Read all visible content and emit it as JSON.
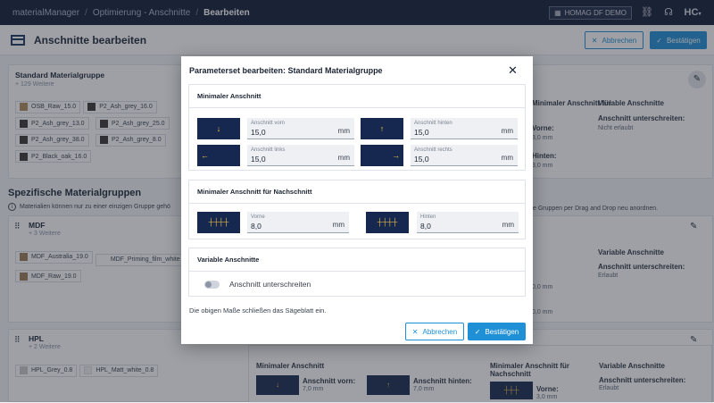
{
  "topbar": {
    "app": "materialManager",
    "crumb1": "Optimierung - Anschnitte",
    "crumb2": "Bearbeiten",
    "demo": "HOMAG DF DEMO",
    "logo": "HC"
  },
  "page": {
    "title": "Anschnitte bearbeiten",
    "cancel": "Abbrechen",
    "confirm": "Bestätigen"
  },
  "bg": {
    "std_title": "Standard Materialgruppe",
    "std_more": "+ 129 Weitere",
    "std_chips": [
      "OSB_Raw_15.0",
      "P2_Ash_grey_16.0",
      "P2_Ash_grey_13.0",
      "P2_Ash_grey_25.0",
      "P2_Ash_grey_38.0",
      "P2_Ash_grey_8.0",
      "P2_Black_oak_16.0"
    ],
    "spec_title": "Spezifische Materialgruppen",
    "info_left": "Materialien können nur zu einer einzigen Gruppe gehö",
    "info_right": "e Gruppen per Drag and Drop neu anordnen.",
    "mdf_title": "MDF",
    "mdf_more": "+ 3 Weitere",
    "mdf_chips": [
      "MDF_Australia_19.0",
      "MDF_Priming_film_white",
      "MDF_Raw_19.0"
    ],
    "hpl_title": "HPL",
    "hpl_more": "+ 2 Weitere",
    "hpl_chips": [
      "HPL_Grey_0.8",
      "HPL_Matt_white_0.8"
    ],
    "col_mn": "Minimaler Anschnitt für",
    "col_var": "Variable Anschnitte",
    "unter": "Anschnitt unterschreiten:",
    "not_allowed": "Nicht erlaubt",
    "allowed": "Erlaubt",
    "vorne": "Vorne:",
    "hinten": "Hinten:",
    "v30": "3,0 mm",
    "v80": "8,0 mm",
    "v00": "0,0 mm",
    "min_anschnitt": "Minimaler Anschnitt",
    "anschnitt_vorn": "Anschnitt vorn:",
    "anschnitt_hinten": "Anschnitt hinten:",
    "v70": "7,0 mm",
    "mn_nach": "Minimaler Anschnitt für",
    "nachschnitt": "Nachschnitt",
    "vorne2": "Vorne:",
    "v30b": "3,0 mm"
  },
  "modal": {
    "title": "Parameterset bearbeiten: Standard Materialgruppe",
    "s1": {
      "title": "Minimaler Anschnitt",
      "vorn": {
        "label": "Anschnitt vorn",
        "value": "15,0",
        "unit": "mm"
      },
      "hinten": {
        "label": "Anschnitt hinten",
        "value": "15,0",
        "unit": "mm"
      },
      "links": {
        "label": "Anschnitt links",
        "value": "15,0",
        "unit": "mm"
      },
      "rechts": {
        "label": "Anschnitt rechts",
        "value": "15,0",
        "unit": "mm"
      }
    },
    "s2": {
      "title": "Minimaler Anschnitt für Nachschnitt",
      "vorne": {
        "label": "Vorne",
        "value": "8,0",
        "unit": "mm"
      },
      "hinten": {
        "label": "Hinten",
        "value": "8,0",
        "unit": "mm"
      }
    },
    "s3": {
      "title": "Variable Anschnitte",
      "toggle": "Anschnitt unterschreiten"
    },
    "note": "Die obigen Maße schließen das Sägeblatt ein.",
    "cancel": "Abbrechen",
    "confirm": "Bestätigen"
  },
  "colors": {
    "accent": "#1f8fd6",
    "navy": "#101a35",
    "saw": "#f5c542"
  }
}
